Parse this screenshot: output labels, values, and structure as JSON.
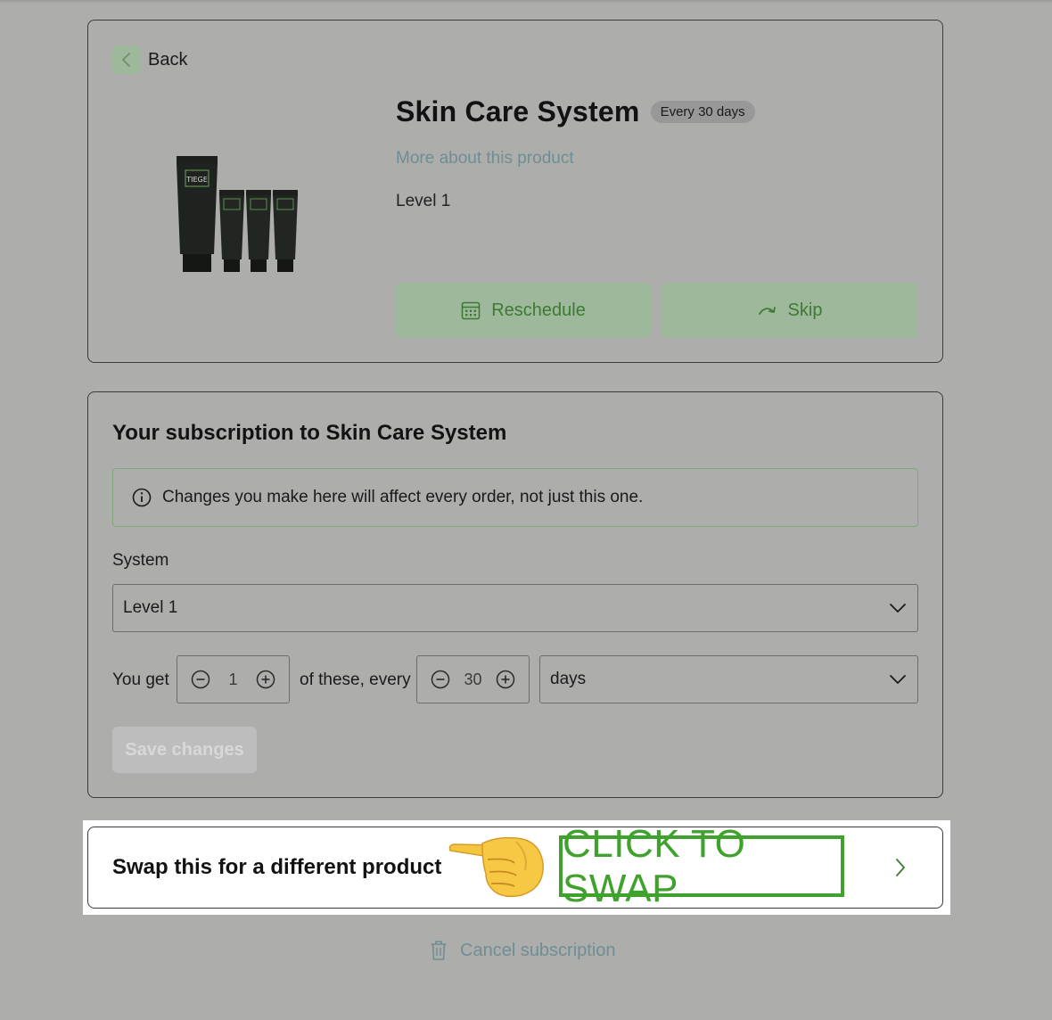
{
  "back": {
    "label": "Back"
  },
  "product": {
    "title": "Skin Care System",
    "frequency_badge": "Every 30 days",
    "more_link": "More about this product",
    "level": "Level 1",
    "image_brand_text": "TIEGE"
  },
  "actions": {
    "reschedule_label": "Reschedule",
    "skip_label": "Skip"
  },
  "subscription": {
    "title": "Your subscription to Skin Care System",
    "info_message": "Changes you make here will affect every order, not just this one.",
    "system_label": "System",
    "system_selected": "Level 1",
    "you_get_label": "You get",
    "quantity": "1",
    "of_these_label": "of these, every",
    "interval": "30",
    "interval_unit": "days",
    "save_label": "Save changes"
  },
  "swap": {
    "label": "Swap this for a different product",
    "callout": "CLICK TO SWAP"
  },
  "cancel": {
    "label": "Cancel subscription"
  },
  "colors": {
    "page_bg": "#adadac",
    "accent_green": "#3d7a33",
    "button_green": "#9db89a",
    "link_teal": "#6f8e93",
    "callout_green": "#3fa22c"
  }
}
